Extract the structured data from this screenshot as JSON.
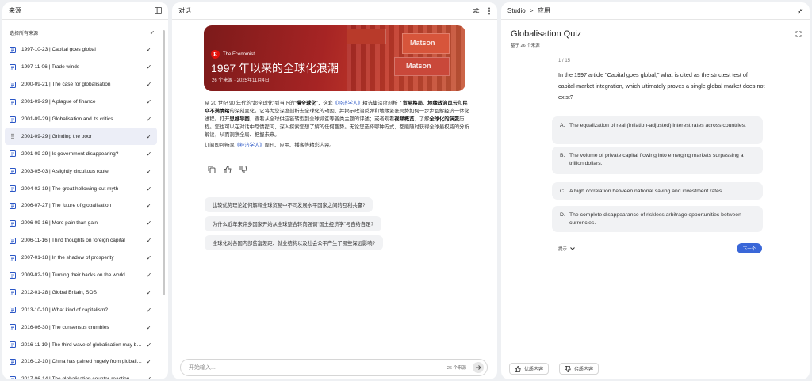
{
  "sources_panel": {
    "title": "来源",
    "select_all_label": "选择所有来源",
    "items": [
      {
        "label": "1997-10-23 | Capital goes global"
      },
      {
        "label": "1997-11-06 | Trade winds"
      },
      {
        "label": "2000-09-21 | The case for globalisation"
      },
      {
        "label": "2001-09-29 | A plague of finance"
      },
      {
        "label": "2001-09-29 | Globalisation and its critics"
      },
      {
        "label": "2001-09-29 | Grinding the poor"
      },
      {
        "label": "2001-09-29 | Is government disappearing?"
      },
      {
        "label": "2003-05-03 | A slightly circuitous route"
      },
      {
        "label": "2004-02-19 | The great hollowing-out myth"
      },
      {
        "label": "2006-07-27 | The future of globalisation"
      },
      {
        "label": "2006-09-16 | More pain than gain"
      },
      {
        "label": "2006-11-16 | Third thoughts on foreign capital"
      },
      {
        "label": "2007-01-18 | In the shadow of prosperity"
      },
      {
        "label": "2009-02-19 | Turning their backs on the world"
      },
      {
        "label": "2012-01-28 | Global Britain, SOS"
      },
      {
        "label": "2013-10-10 | What kind of capitalism?"
      },
      {
        "label": "2016-06-30 | The consensus crumbles"
      },
      {
        "label": "2016-11-19 | The third wave of globalisation may be t..."
      },
      {
        "label": "2016-12-10 | China has gained hugely from globalisa..."
      },
      {
        "label": "2017-06-14 | The globalisation counter-reaction"
      }
    ]
  },
  "chat_panel": {
    "title": "对话",
    "hero": {
      "brand": "The Economist",
      "brand_letter": "E",
      "title": "1997 年以来的全球化浪潮",
      "subtitle": "26 个来源 · 2025年11月4日",
      "container_text": "Matson"
    },
    "body": {
      "p1_a": "从 20 世纪 90 年代的“超全球化”到当下的“",
      "p1_b1": "慢全球化",
      "p1_c": "”，这套",
      "p1_link": "《经济学人》",
      "p1_d": "精选集深度剖析了",
      "p1_b2": "贸易格局、地缘政治风云",
      "p1_e": "和",
      "p1_b3": "民众不满情绪",
      "p1_f": "的深刻变化。它将为您深度剖析去全球化的动因，并揭示政治反弹和地缘紧张局势如何一步步瓦解经济一体化进程。打开",
      "p1_b4": "思维导图",
      "p1_g": "，查看从全球供应链转型到全球减贫等各类主题的评述；或者观看",
      "p1_b5": "视频概览",
      "p1_h": "，了解",
      "p1_b6": "全球化的演变",
      "p1_i": "历程。您也可以在对话中尽情提问，深入探索您想了解的任何趣势。无论您选择哪种方式，都能随时获得全球最权威的分析解读，从而洞察全局、把握未来。",
      "p2_a": "订阅即可畅享",
      "p2_link": "《经济学人》",
      "p2_b": "周刊、应用、播客等精彩内容。"
    },
    "suggestions": [
      "比较优势理论如何解释全球贸易中不同发展水平国家之间的互利共赢?",
      "为什么近年来许多国家开始从全球整合转向强调“国土经济学”与自给自足?",
      "全球化对各国内部贫富差距、就业结构以及社会公平产生了哪些深远影响?"
    ],
    "input_placeholder": "开始输入...",
    "source_count": "26 个来源"
  },
  "studio_panel": {
    "breadcrumb_root": "Studio",
    "breadcrumb_sep": ">",
    "breadcrumb_current": "应用",
    "quiz_title": "Globalisation Quiz",
    "quiz_subtitle": "基于 26 个来源",
    "question_number": "1 / 15",
    "question": "In the 1997 article \"Capital goes global,\" what is cited as the strictest test of capital-market integration, which ultimately proves a single global market does not exist?",
    "options": [
      {
        "key": "A.",
        "text": "The equalization of real (inflation-adjusted) interest rates across countries."
      },
      {
        "key": "B.",
        "text": "The volume of private capital flowing into emerging markets surpassing a trillion dollars."
      },
      {
        "key": "C.",
        "text": "A high correlation between national saving and investment rates."
      },
      {
        "key": "D.",
        "text": "The complete disappearance of riskless arbitrage opportunities between currencies."
      }
    ],
    "hint_label": "提示",
    "next_label": "下一个",
    "good_content_label": "优质内容",
    "bad_content_label": "劣质内容"
  }
}
